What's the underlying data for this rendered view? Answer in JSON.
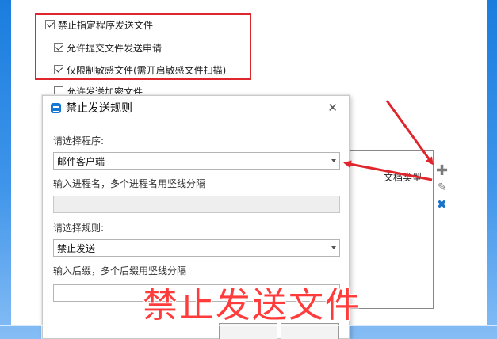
{
  "settings": {
    "options": [
      {
        "label": "禁止指定程序发送文件",
        "checked": true
      },
      {
        "label": "允许提交文件发送申请",
        "checked": true
      },
      {
        "label": "仅限制敏感文件(需开启敏感文件扫描)",
        "checked": true
      },
      {
        "label": "允许发送加密文件",
        "checked": false
      }
    ]
  },
  "right_panel": {
    "column_header": "文档类型",
    "icons": [
      "add-icon",
      "edit-icon",
      "delete-icon"
    ]
  },
  "dialog": {
    "title": "禁止发送规则",
    "close_symbol": "✕",
    "program_label": "请选择程序:",
    "program_value": "邮件客户端",
    "process_label": "输入进程名，多个进程名用竖线分隔",
    "process_value": "",
    "rule_label": "请选择规则:",
    "rule_value": "禁止发送",
    "suffix_label": "输入后缀，多个后缀用竖线分隔",
    "suffix_value": ""
  },
  "annotation": {
    "overlay_text": "禁止发送文件",
    "color": "#ff3b3b",
    "highlight_color": "#e0262d"
  }
}
